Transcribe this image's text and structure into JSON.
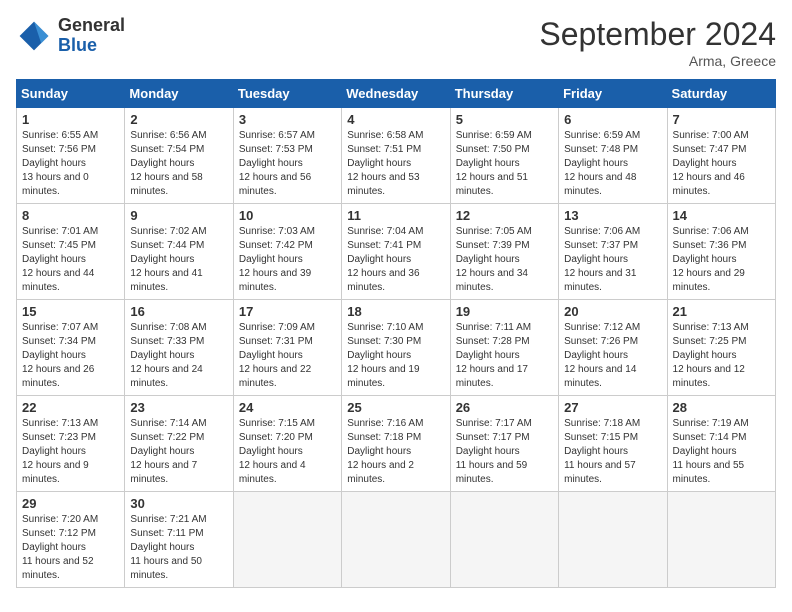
{
  "header": {
    "logo_general": "General",
    "logo_blue": "Blue",
    "month_year": "September 2024",
    "location": "Arma, Greece"
  },
  "weekdays": [
    "Sunday",
    "Monday",
    "Tuesday",
    "Wednesday",
    "Thursday",
    "Friday",
    "Saturday"
  ],
  "weeks": [
    [
      {
        "day": "1",
        "sunrise": "6:55 AM",
        "sunset": "7:56 PM",
        "daylight": "13 hours and 0 minutes."
      },
      {
        "day": "2",
        "sunrise": "6:56 AM",
        "sunset": "7:54 PM",
        "daylight": "12 hours and 58 minutes."
      },
      {
        "day": "3",
        "sunrise": "6:57 AM",
        "sunset": "7:53 PM",
        "daylight": "12 hours and 56 minutes."
      },
      {
        "day": "4",
        "sunrise": "6:58 AM",
        "sunset": "7:51 PM",
        "daylight": "12 hours and 53 minutes."
      },
      {
        "day": "5",
        "sunrise": "6:59 AM",
        "sunset": "7:50 PM",
        "daylight": "12 hours and 51 minutes."
      },
      {
        "day": "6",
        "sunrise": "6:59 AM",
        "sunset": "7:48 PM",
        "daylight": "12 hours and 48 minutes."
      },
      {
        "day": "7",
        "sunrise": "7:00 AM",
        "sunset": "7:47 PM",
        "daylight": "12 hours and 46 minutes."
      }
    ],
    [
      {
        "day": "8",
        "sunrise": "7:01 AM",
        "sunset": "7:45 PM",
        "daylight": "12 hours and 44 minutes."
      },
      {
        "day": "9",
        "sunrise": "7:02 AM",
        "sunset": "7:44 PM",
        "daylight": "12 hours and 41 minutes."
      },
      {
        "day": "10",
        "sunrise": "7:03 AM",
        "sunset": "7:42 PM",
        "daylight": "12 hours and 39 minutes."
      },
      {
        "day": "11",
        "sunrise": "7:04 AM",
        "sunset": "7:41 PM",
        "daylight": "12 hours and 36 minutes."
      },
      {
        "day": "12",
        "sunrise": "7:05 AM",
        "sunset": "7:39 PM",
        "daylight": "12 hours and 34 minutes."
      },
      {
        "day": "13",
        "sunrise": "7:06 AM",
        "sunset": "7:37 PM",
        "daylight": "12 hours and 31 minutes."
      },
      {
        "day": "14",
        "sunrise": "7:06 AM",
        "sunset": "7:36 PM",
        "daylight": "12 hours and 29 minutes."
      }
    ],
    [
      {
        "day": "15",
        "sunrise": "7:07 AM",
        "sunset": "7:34 PM",
        "daylight": "12 hours and 26 minutes."
      },
      {
        "day": "16",
        "sunrise": "7:08 AM",
        "sunset": "7:33 PM",
        "daylight": "12 hours and 24 minutes."
      },
      {
        "day": "17",
        "sunrise": "7:09 AM",
        "sunset": "7:31 PM",
        "daylight": "12 hours and 22 minutes."
      },
      {
        "day": "18",
        "sunrise": "7:10 AM",
        "sunset": "7:30 PM",
        "daylight": "12 hours and 19 minutes."
      },
      {
        "day": "19",
        "sunrise": "7:11 AM",
        "sunset": "7:28 PM",
        "daylight": "12 hours and 17 minutes."
      },
      {
        "day": "20",
        "sunrise": "7:12 AM",
        "sunset": "7:26 PM",
        "daylight": "12 hours and 14 minutes."
      },
      {
        "day": "21",
        "sunrise": "7:13 AM",
        "sunset": "7:25 PM",
        "daylight": "12 hours and 12 minutes."
      }
    ],
    [
      {
        "day": "22",
        "sunrise": "7:13 AM",
        "sunset": "7:23 PM",
        "daylight": "12 hours and 9 minutes."
      },
      {
        "day": "23",
        "sunrise": "7:14 AM",
        "sunset": "7:22 PM",
        "daylight": "12 hours and 7 minutes."
      },
      {
        "day": "24",
        "sunrise": "7:15 AM",
        "sunset": "7:20 PM",
        "daylight": "12 hours and 4 minutes."
      },
      {
        "day": "25",
        "sunrise": "7:16 AM",
        "sunset": "7:18 PM",
        "daylight": "12 hours and 2 minutes."
      },
      {
        "day": "26",
        "sunrise": "7:17 AM",
        "sunset": "7:17 PM",
        "daylight": "11 hours and 59 minutes."
      },
      {
        "day": "27",
        "sunrise": "7:18 AM",
        "sunset": "7:15 PM",
        "daylight": "11 hours and 57 minutes."
      },
      {
        "day": "28",
        "sunrise": "7:19 AM",
        "sunset": "7:14 PM",
        "daylight": "11 hours and 55 minutes."
      }
    ],
    [
      {
        "day": "29",
        "sunrise": "7:20 AM",
        "sunset": "7:12 PM",
        "daylight": "11 hours and 52 minutes."
      },
      {
        "day": "30",
        "sunrise": "7:21 AM",
        "sunset": "7:11 PM",
        "daylight": "11 hours and 50 minutes."
      },
      null,
      null,
      null,
      null,
      null
    ]
  ]
}
